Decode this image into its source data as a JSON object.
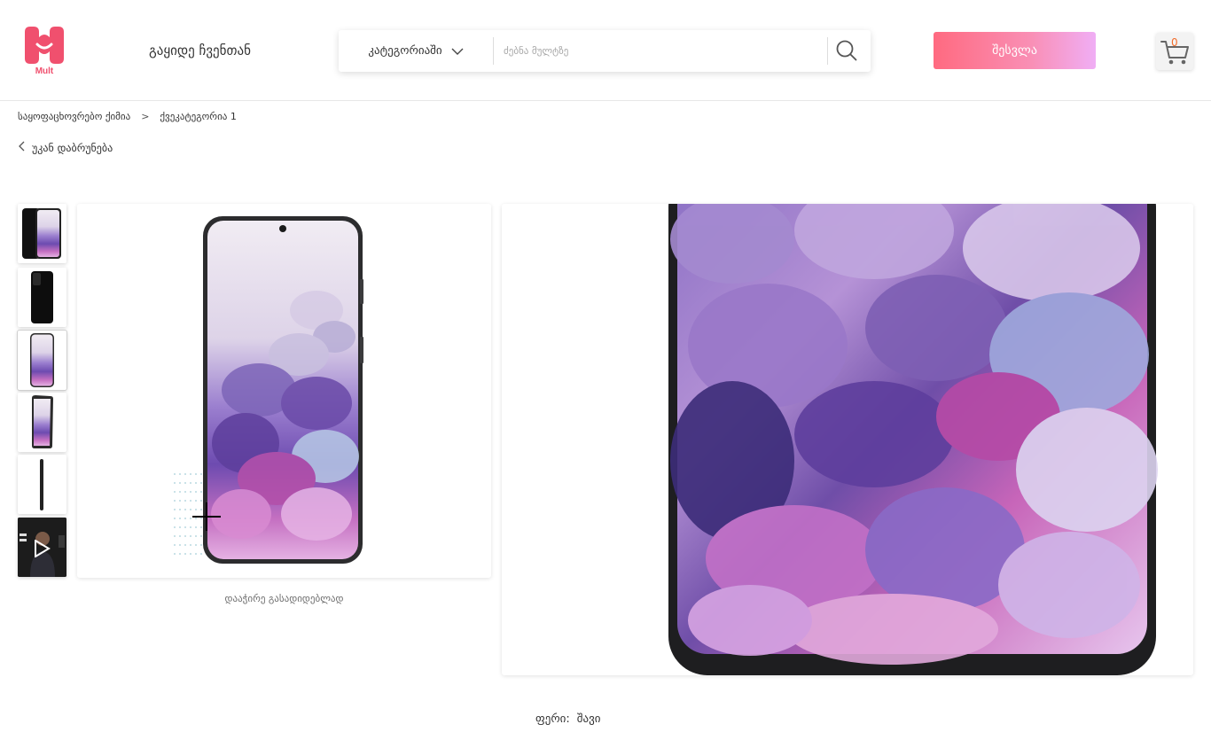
{
  "header": {
    "logo_text": "Mult",
    "sell_link": "გაყიდე ჩვენთან",
    "search": {
      "category_label": "კატეგორიაში",
      "placeholder": "ძებნა მულტზე",
      "value": ""
    },
    "login_label": "შესვლა",
    "cart_count": "0"
  },
  "breadcrumb": {
    "items": [
      "საყოფაცხოვრებო ქიმია",
      "ქვეკატეგორია 1"
    ],
    "separator": ">"
  },
  "back_label": "უკან დაბრუნება",
  "gallery": {
    "thumbnails": [
      {
        "kind": "front-back"
      },
      {
        "kind": "back-black"
      },
      {
        "kind": "front-screen",
        "active": true
      },
      {
        "kind": "angled"
      },
      {
        "kind": "side"
      },
      {
        "kind": "video"
      }
    ],
    "zoom_hint": "დააჭირე გასადიდებლად"
  },
  "product": {
    "color_label": "ფერი:",
    "color_value": "შავი"
  },
  "colors": {
    "brand": "#f0506e",
    "login_gradient_start": "#ff6a80",
    "login_gradient_end": "#f0aef5",
    "cart_count": "#f26c2a"
  }
}
